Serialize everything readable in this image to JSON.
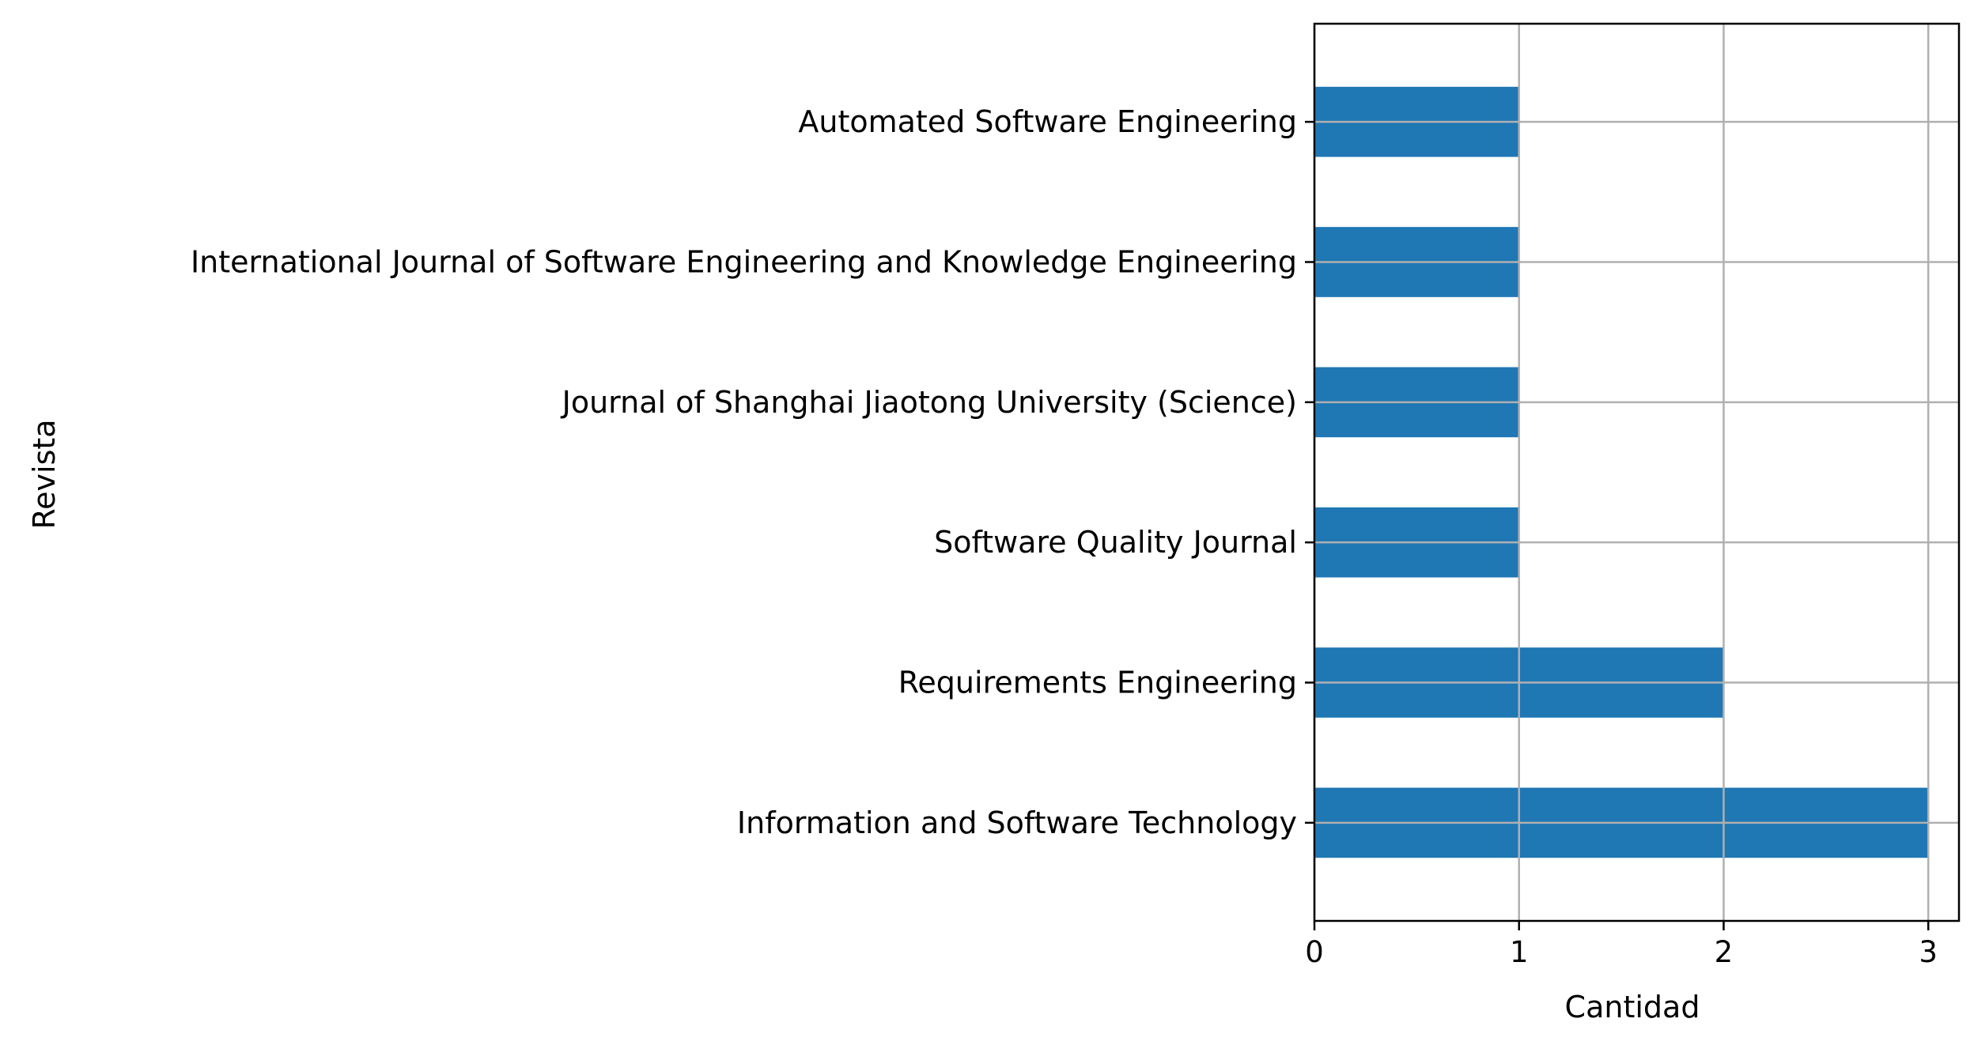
{
  "chart_data": {
    "type": "bar",
    "orientation": "horizontal",
    "categories": [
      "Information and Software Technology",
      "Requirements Engineering",
      "Software Quality Journal",
      "Journal of Shanghai Jiaotong University (Science)",
      "International Journal of Software Engineering and Knowledge Engineering",
      "Automated Software Engineering"
    ],
    "values": [
      3,
      2,
      1,
      1,
      1,
      1
    ],
    "xlabel": "Cantidad",
    "ylabel": "Revista",
    "xlim": [
      0,
      3.15
    ],
    "xticks": [
      0,
      1,
      2,
      3
    ],
    "grid": true,
    "legend": "none",
    "colors": {
      "bar": "#1f77b4",
      "grid": "#b0b0b0",
      "axis": "#000000"
    }
  }
}
